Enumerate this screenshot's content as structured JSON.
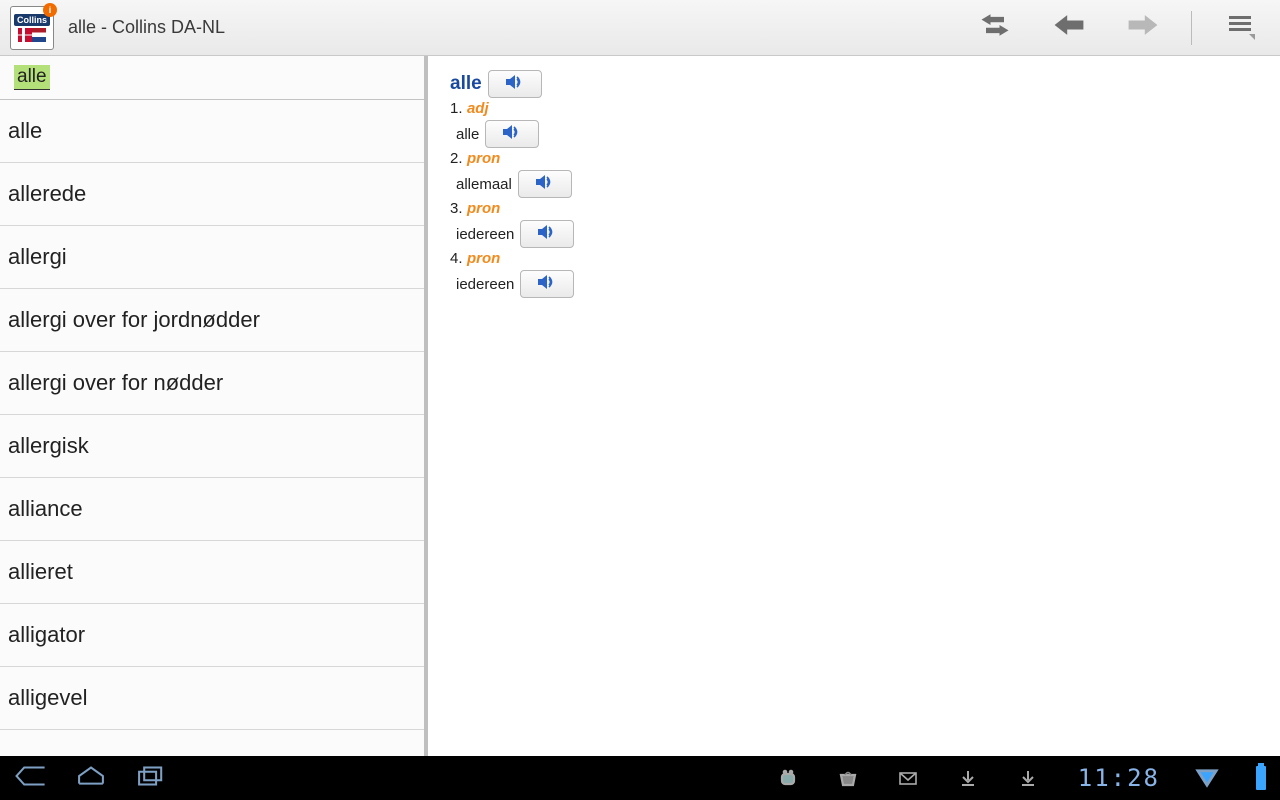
{
  "header": {
    "title": "alle - Collins DA-NL",
    "app_badge": "i",
    "app_brand": "Collins"
  },
  "search": {
    "value": "alle"
  },
  "wordlist": [
    {
      "label": "alle"
    },
    {
      "label": "allerede"
    },
    {
      "label": "allergi"
    },
    {
      "label": "allergi over for jordnødder"
    },
    {
      "label": "allergi over for nødder"
    },
    {
      "label": "allergisk"
    },
    {
      "label": "alliance"
    },
    {
      "label": "allieret"
    },
    {
      "label": "alligator"
    },
    {
      "label": "alligevel"
    }
  ],
  "entry": {
    "headword": "alle",
    "senses": [
      {
        "num": "1.",
        "pos": "adj",
        "trans": "alle"
      },
      {
        "num": "2.",
        "pos": "pron",
        "trans": "allemaal"
      },
      {
        "num": "3.",
        "pos": "pron",
        "trans": "iedereen"
      },
      {
        "num": "4.",
        "pos": "pron",
        "trans": "iedereen"
      }
    ]
  },
  "sysbar": {
    "time": "11:28"
  }
}
